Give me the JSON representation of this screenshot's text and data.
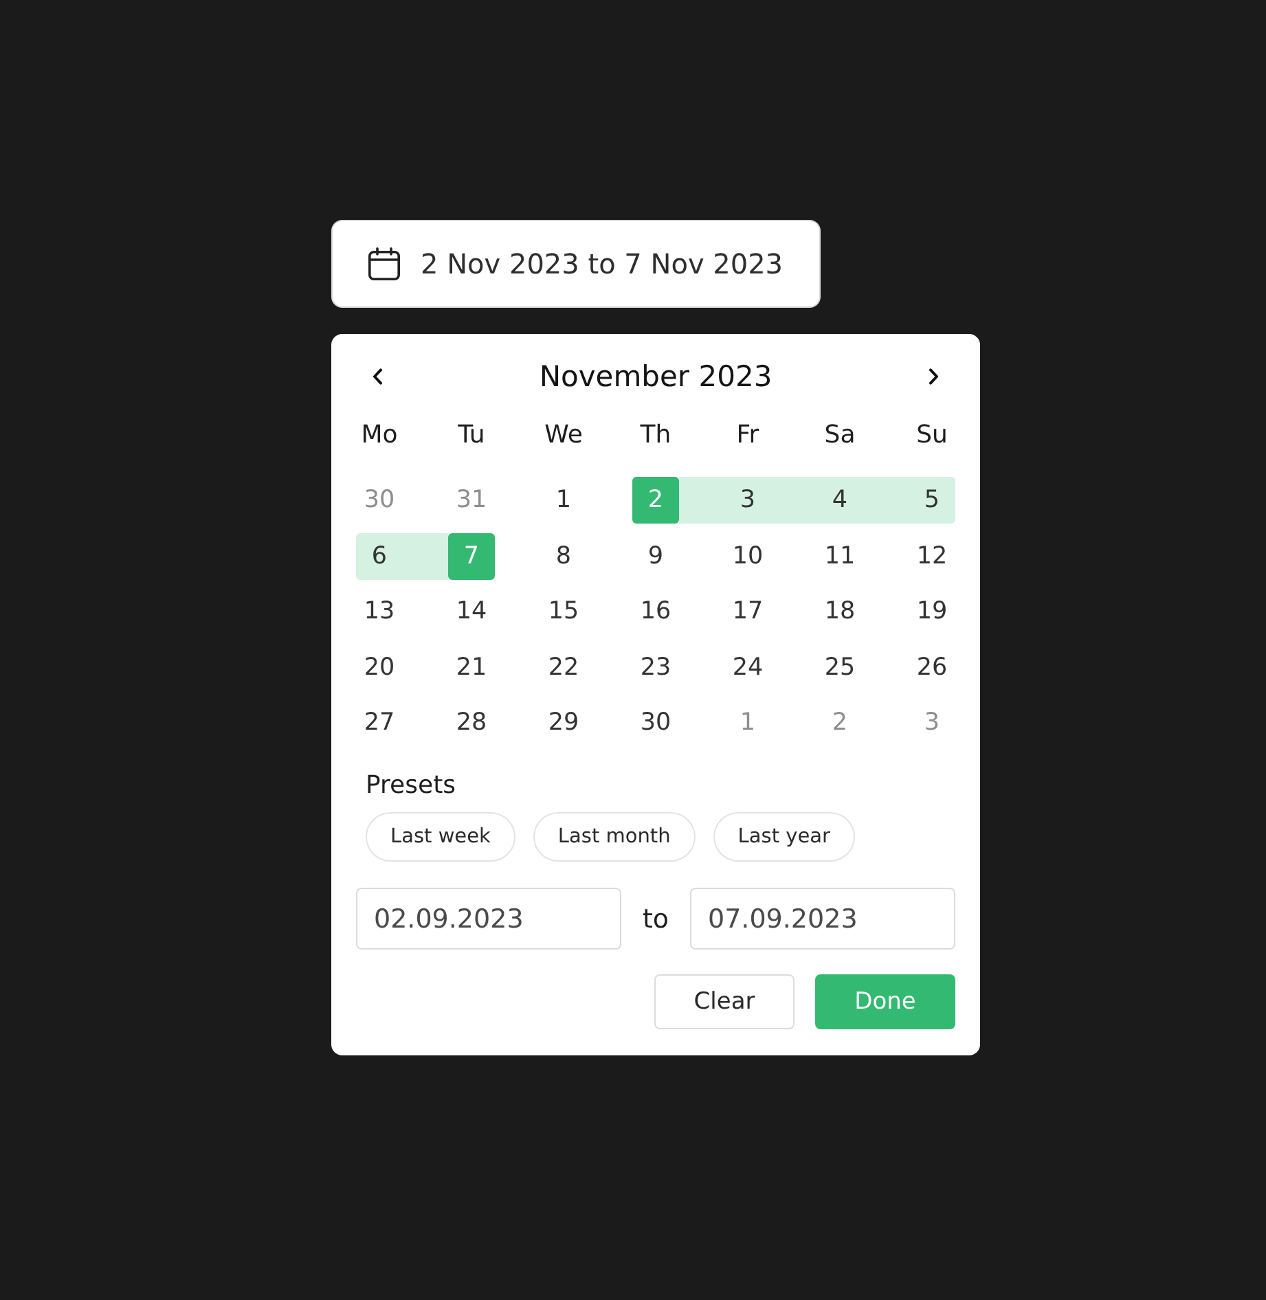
{
  "date_range_button": {
    "value": "2 Nov 2023 to 7 Nov 2023"
  },
  "calendar": {
    "title": "November 2023",
    "weekdays": [
      "Mo",
      "Tu",
      "We",
      "Th",
      "Fr",
      "Sa",
      "Su"
    ],
    "weeks": [
      [
        {
          "label": "30",
          "outside": true,
          "selected": false,
          "in_range": false
        },
        {
          "label": "31",
          "outside": true,
          "selected": false,
          "in_range": false
        },
        {
          "label": "1",
          "outside": false,
          "selected": false,
          "in_range": false
        },
        {
          "label": "2",
          "outside": false,
          "selected": true,
          "in_range": false
        },
        {
          "label": "3",
          "outside": false,
          "selected": false,
          "in_range": true
        },
        {
          "label": "4",
          "outside": false,
          "selected": false,
          "in_range": true
        },
        {
          "label": "5",
          "outside": false,
          "selected": false,
          "in_range": true
        }
      ],
      [
        {
          "label": "6",
          "outside": false,
          "selected": false,
          "in_range": true
        },
        {
          "label": "7",
          "outside": false,
          "selected": true,
          "in_range": false
        },
        {
          "label": "8",
          "outside": false,
          "selected": false,
          "in_range": false
        },
        {
          "label": "9",
          "outside": false,
          "selected": false,
          "in_range": false
        },
        {
          "label": "10",
          "outside": false,
          "selected": false,
          "in_range": false
        },
        {
          "label": "11",
          "outside": false,
          "selected": false,
          "in_range": false
        },
        {
          "label": "12",
          "outside": false,
          "selected": false,
          "in_range": false
        }
      ],
      [
        {
          "label": "13",
          "outside": false,
          "selected": false,
          "in_range": false
        },
        {
          "label": "14",
          "outside": false,
          "selected": false,
          "in_range": false
        },
        {
          "label": "15",
          "outside": false,
          "selected": false,
          "in_range": false
        },
        {
          "label": "16",
          "outside": false,
          "selected": false,
          "in_range": false
        },
        {
          "label": "17",
          "outside": false,
          "selected": false,
          "in_range": false
        },
        {
          "label": "18",
          "outside": false,
          "selected": false,
          "in_range": false
        },
        {
          "label": "19",
          "outside": false,
          "selected": false,
          "in_range": false
        }
      ],
      [
        {
          "label": "20",
          "outside": false,
          "selected": false,
          "in_range": false
        },
        {
          "label": "21",
          "outside": false,
          "selected": false,
          "in_range": false
        },
        {
          "label": "22",
          "outside": false,
          "selected": false,
          "in_range": false
        },
        {
          "label": "23",
          "outside": false,
          "selected": false,
          "in_range": false
        },
        {
          "label": "24",
          "outside": false,
          "selected": false,
          "in_range": false
        },
        {
          "label": "25",
          "outside": false,
          "selected": false,
          "in_range": false
        },
        {
          "label": "26",
          "outside": false,
          "selected": false,
          "in_range": false
        }
      ],
      [
        {
          "label": "27",
          "outside": false,
          "selected": false,
          "in_range": false
        },
        {
          "label": "28",
          "outside": false,
          "selected": false,
          "in_range": false
        },
        {
          "label": "29",
          "outside": false,
          "selected": false,
          "in_range": false
        },
        {
          "label": "30",
          "outside": false,
          "selected": false,
          "in_range": false
        },
        {
          "label": "1",
          "outside": true,
          "selected": false,
          "in_range": false
        },
        {
          "label": "2",
          "outside": true,
          "selected": false,
          "in_range": false
        },
        {
          "label": "3",
          "outside": true,
          "selected": false,
          "in_range": false
        }
      ]
    ]
  },
  "presets": {
    "title": "Presets",
    "items": [
      {
        "label": "Last week",
        "selected": false
      },
      {
        "label": "Last month",
        "selected": false
      },
      {
        "label": "Last year",
        "selected": false
      }
    ]
  },
  "range_inputs": {
    "start": {
      "value": "02.09.2023"
    },
    "separator": "to",
    "end": {
      "value": "07.09.2023"
    }
  },
  "actions": [
    {
      "label": "Clear",
      "kind": "secondary"
    },
    {
      "label": "Done",
      "kind": "primary"
    }
  ]
}
